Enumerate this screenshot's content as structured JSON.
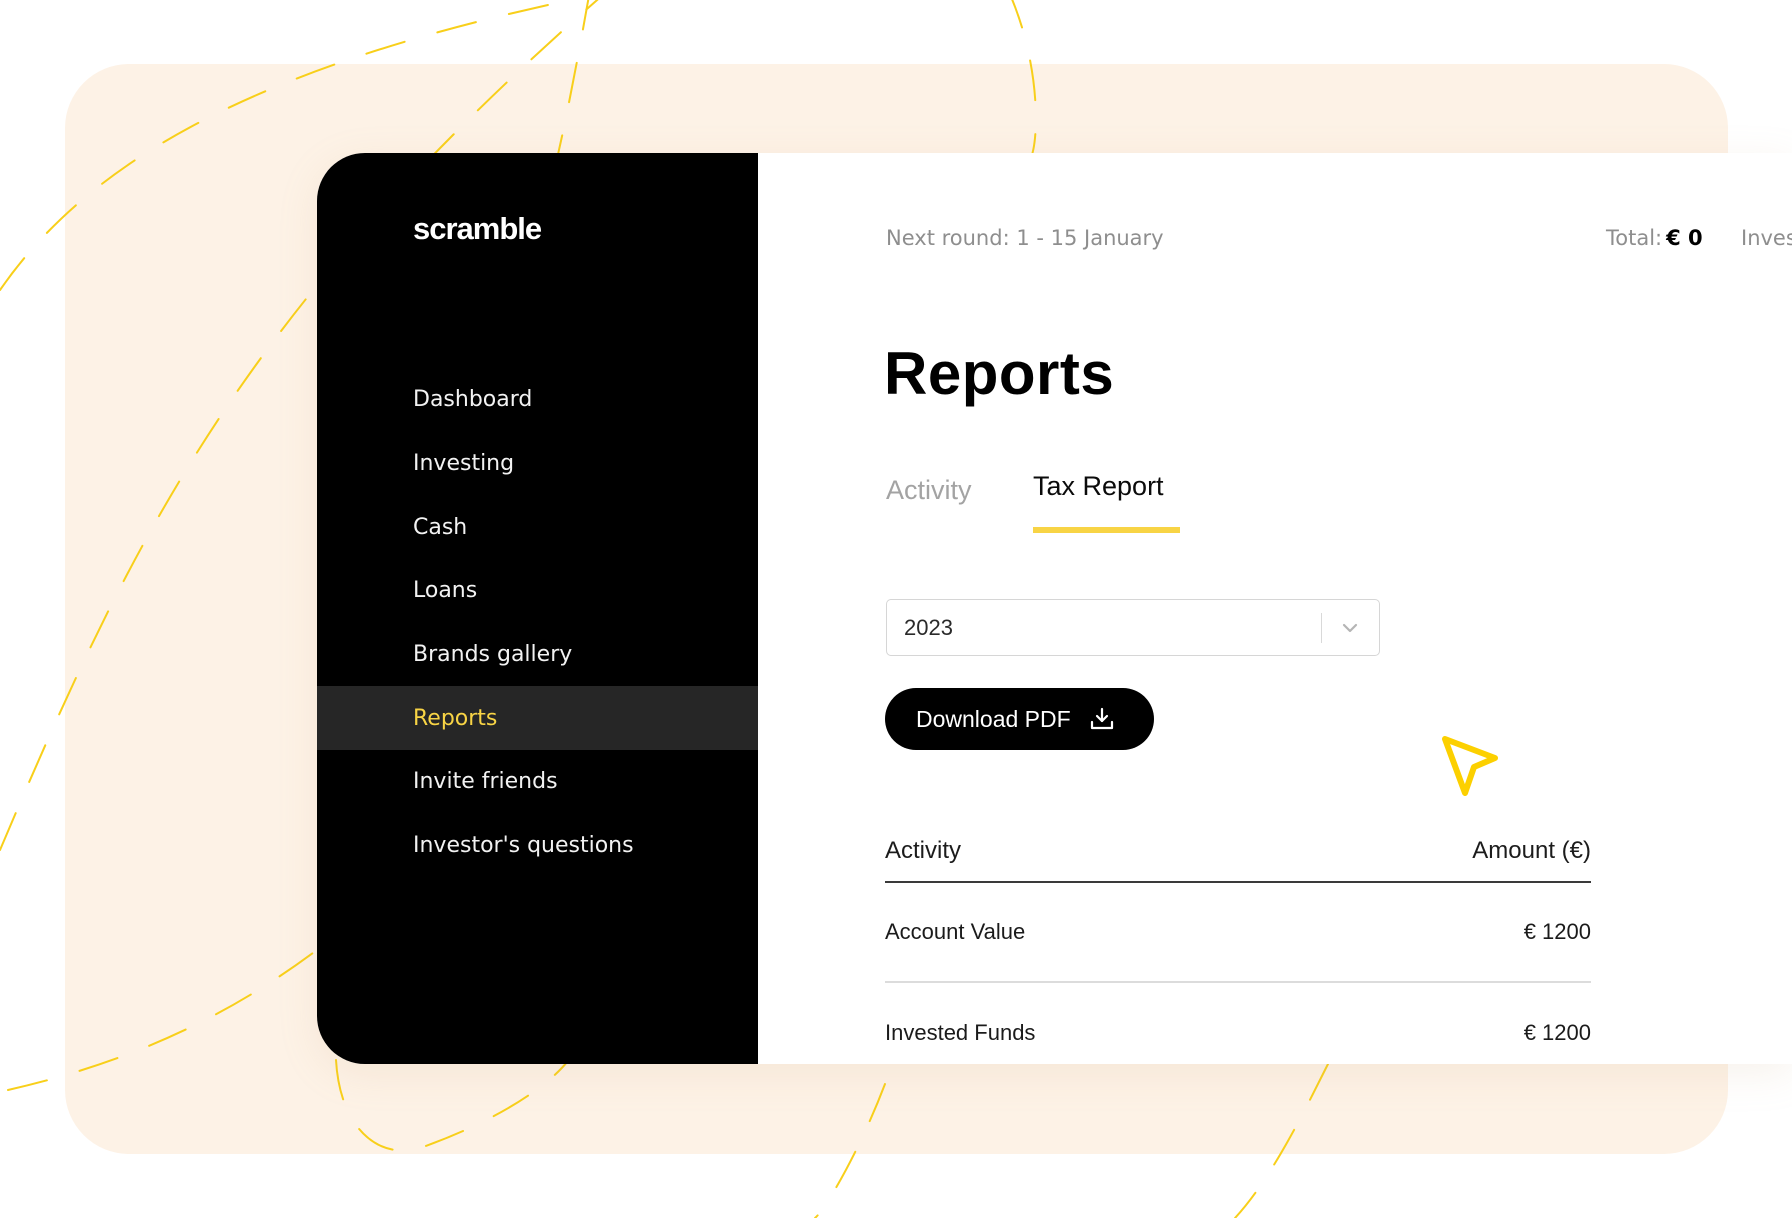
{
  "brand": {
    "name": "scramble",
    "accent_color": "#f8d445",
    "background_color": "#fdf2e6"
  },
  "sidebar": {
    "items": [
      {
        "label": "Dashboard",
        "active": false
      },
      {
        "label": "Investing",
        "active": false
      },
      {
        "label": "Cash",
        "active": false
      },
      {
        "label": "Loans",
        "active": false
      },
      {
        "label": "Brands gallery",
        "active": false
      },
      {
        "label": "Reports",
        "active": true
      },
      {
        "label": "Invite friends",
        "active": false
      },
      {
        "label": "Investor's questions",
        "active": false
      }
    ]
  },
  "topbar": {
    "next_round": "Next round: 1 - 15 January",
    "total_label": "Total:",
    "total_value": "€ 0",
    "invested_label_truncated": "Inves"
  },
  "page": {
    "title": "Reports",
    "tabs": [
      {
        "label": "Activity",
        "active": false
      },
      {
        "label": "Tax Report",
        "active": true
      }
    ],
    "year_select": {
      "value": "2023",
      "icon": "chevron-down-icon"
    },
    "download_button": {
      "label": "Download PDF",
      "icon": "download-icon"
    },
    "table": {
      "columns": [
        "Activity",
        "Amount (€)"
      ],
      "rows": [
        {
          "activity": "Account Value",
          "amount": "€ 1200"
        },
        {
          "activity": "Invested Funds",
          "amount": "€ 1200"
        }
      ]
    }
  }
}
